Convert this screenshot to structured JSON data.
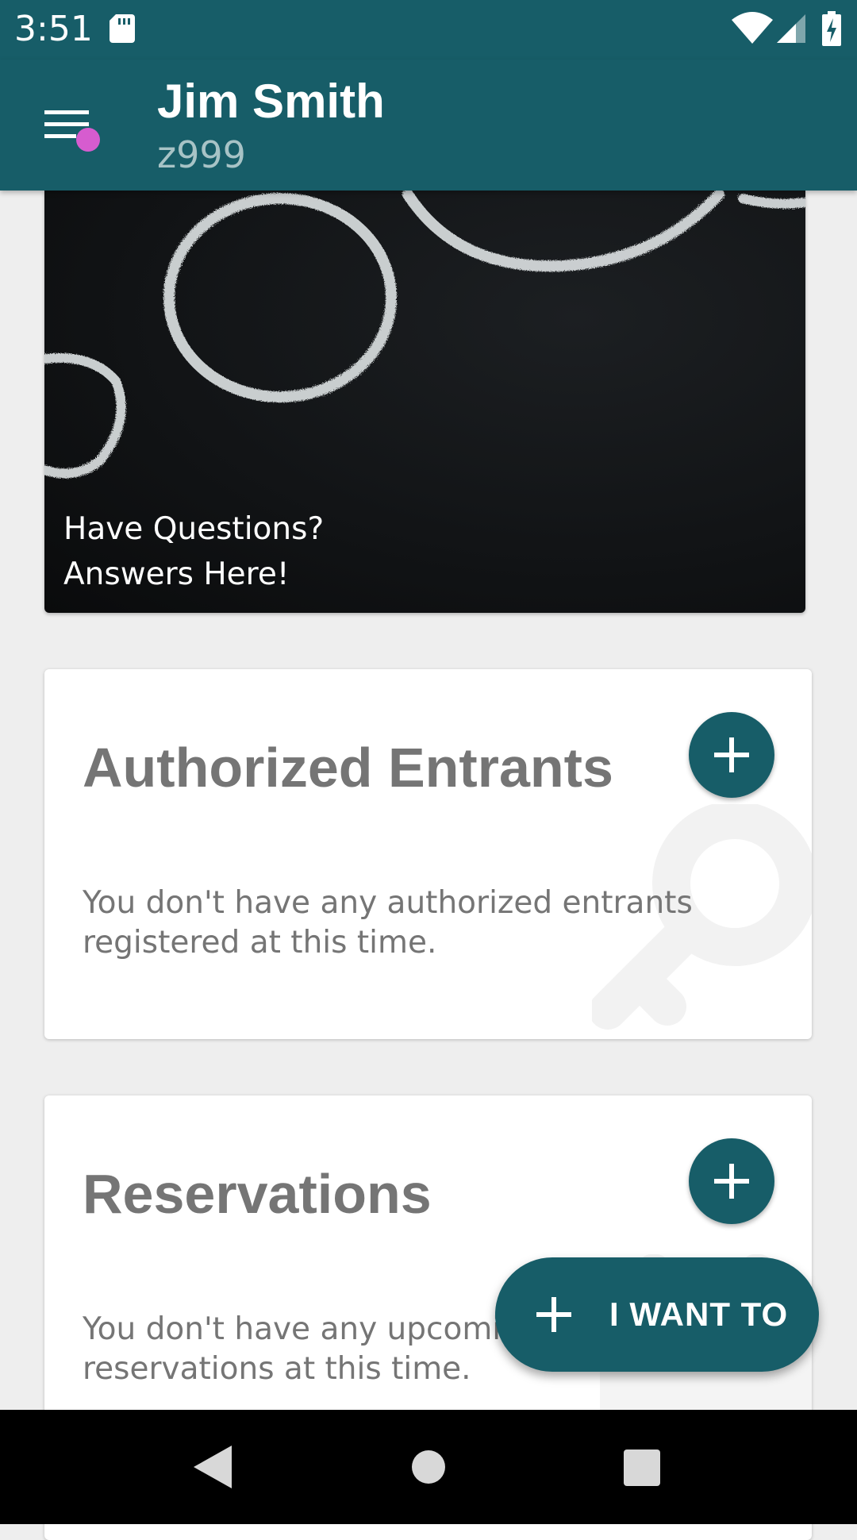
{
  "status_bar": {
    "time": "3:51",
    "icons": [
      "sd-card-icon",
      "wifi-icon",
      "cell-signal-icon",
      "battery-charging-icon"
    ]
  },
  "app_bar": {
    "title": "Jim Smith",
    "subtitle": "z999",
    "menu_icon": "hamburger-menu-icon",
    "notification_dot_color": "#d65ccf"
  },
  "banner": {
    "text": "Have Questions?\nAnswers Here!"
  },
  "cards": {
    "authorized_entrants": {
      "title": "Authorized Entrants",
      "body": "You don't have any authorized entrants registered at this time.",
      "add_icon": "plus-icon",
      "watermark_icon": "key-icon"
    },
    "reservations": {
      "title": "Reservations",
      "body": "You don't have any upcoming reservations at this time.",
      "add_icon": "plus-icon",
      "watermark_icon": "calendar-icon"
    }
  },
  "fab": {
    "label": "I WANT TO",
    "icon": "plus-icon"
  },
  "nav_bar": {
    "icons": [
      "back-icon",
      "home-icon",
      "recents-icon"
    ]
  },
  "colors": {
    "primary": "#175d68",
    "background": "#eeeeee",
    "card_text": "#757575",
    "subtitle": "#a7c3c6"
  }
}
